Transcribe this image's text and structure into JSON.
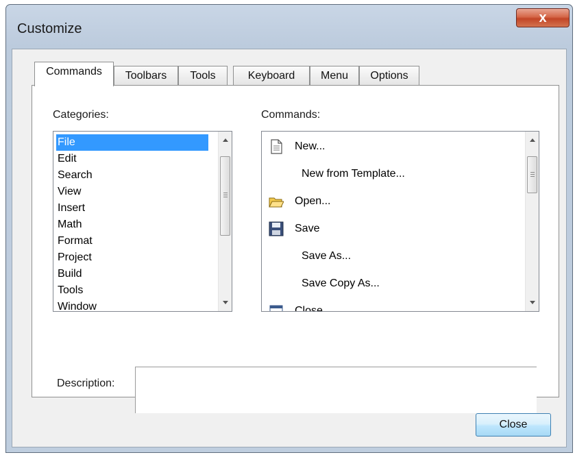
{
  "window": {
    "title": "Customize",
    "close_glyph": "x"
  },
  "tabs": [
    {
      "label": "Commands",
      "active": true
    },
    {
      "label": "Toolbars",
      "active": false
    },
    {
      "label": "Tools",
      "active": false
    },
    {
      "label": "Keyboard",
      "active": false
    },
    {
      "label": "Menu",
      "active": false
    },
    {
      "label": "Options",
      "active": false
    }
  ],
  "categories": {
    "label": "Categories:",
    "items": [
      "File",
      "Edit",
      "Search",
      "View",
      "Insert",
      "Math",
      "Format",
      "Project",
      "Build",
      "Tools",
      "Window"
    ],
    "selected": "File"
  },
  "commands": {
    "label": "Commands:",
    "items": [
      {
        "label": "New...",
        "icon": "new-document-icon"
      },
      {
        "label": "New from Template...",
        "icon": ""
      },
      {
        "label": "Open...",
        "icon": "open-folder-icon"
      },
      {
        "label": "Save",
        "icon": "floppy-disk-icon"
      },
      {
        "label": "Save As...",
        "icon": ""
      },
      {
        "label": "Save Copy As...",
        "icon": ""
      },
      {
        "label": "Close",
        "icon": "close-document-icon"
      }
    ]
  },
  "description": {
    "label": "Description:",
    "value": ""
  },
  "buttons": {
    "close_label": "Close"
  },
  "colors": {
    "selection": "#3399ff",
    "titlebar": "#bfcedf",
    "close_button": "#c24527"
  }
}
